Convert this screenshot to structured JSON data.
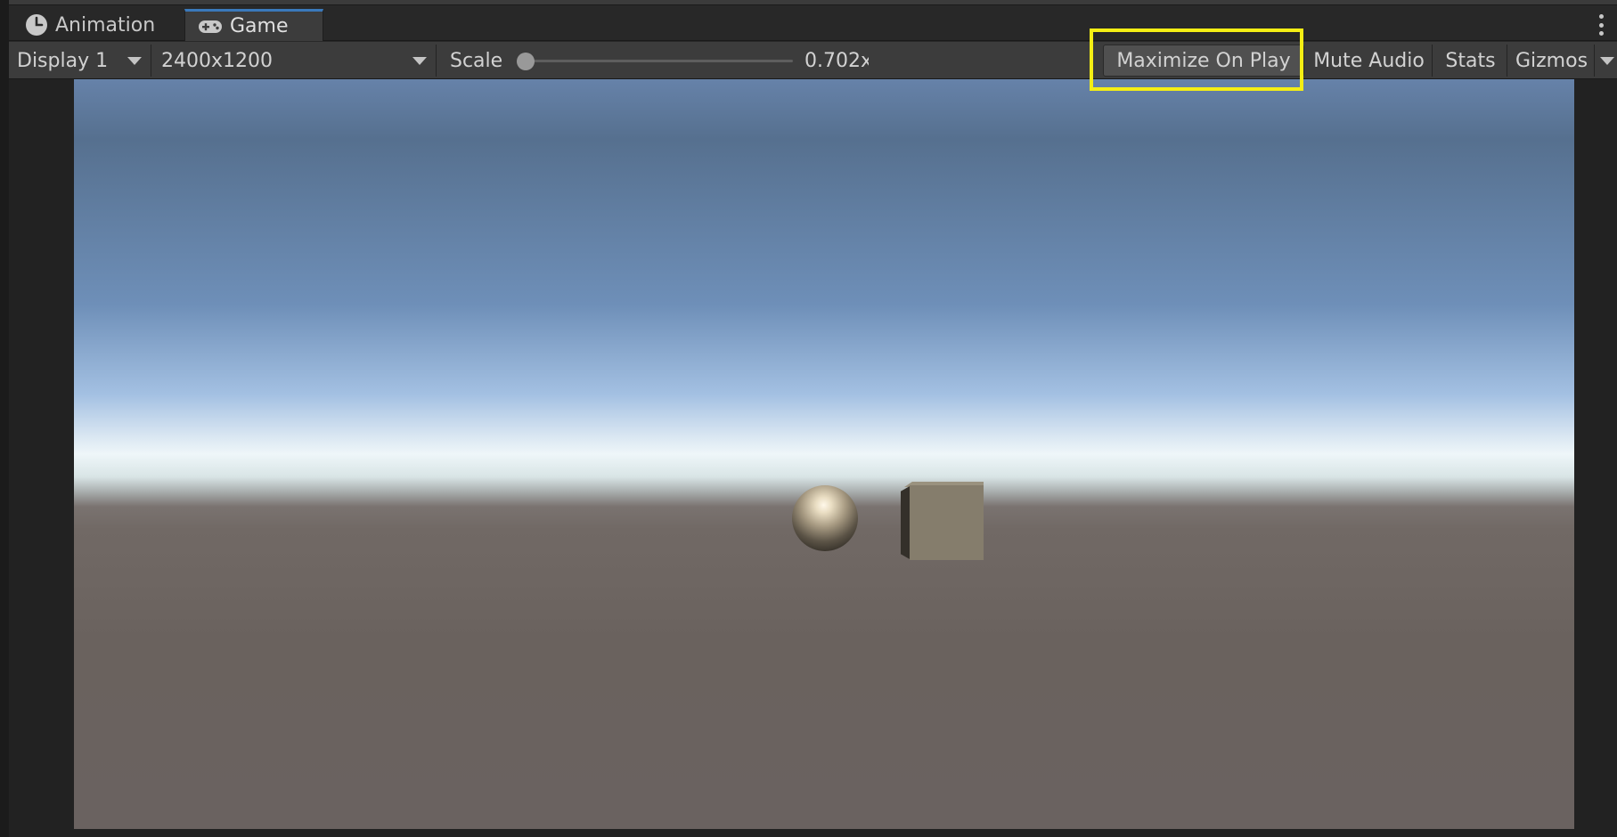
{
  "tabs": [
    {
      "label": "Animation",
      "icon": "clock-icon",
      "active": false
    },
    {
      "label": "Game",
      "icon": "gamepad-icon",
      "active": true
    }
  ],
  "toolbar": {
    "display_label": "Display 1",
    "resolution_label": "2400x1200",
    "scale_label": "Scale",
    "scale_value": "0.702x",
    "scale_fraction": 0.0,
    "maximize_label": "Maximize On Play",
    "mute_label": "Mute Audio",
    "stats_label": "Stats",
    "gizmos_label": "Gizmos"
  },
  "colors": {
    "highlight": "#f4ee14",
    "active_tab_accent": "#3a79bb",
    "toolbar_bg": "#3c3c3c"
  }
}
